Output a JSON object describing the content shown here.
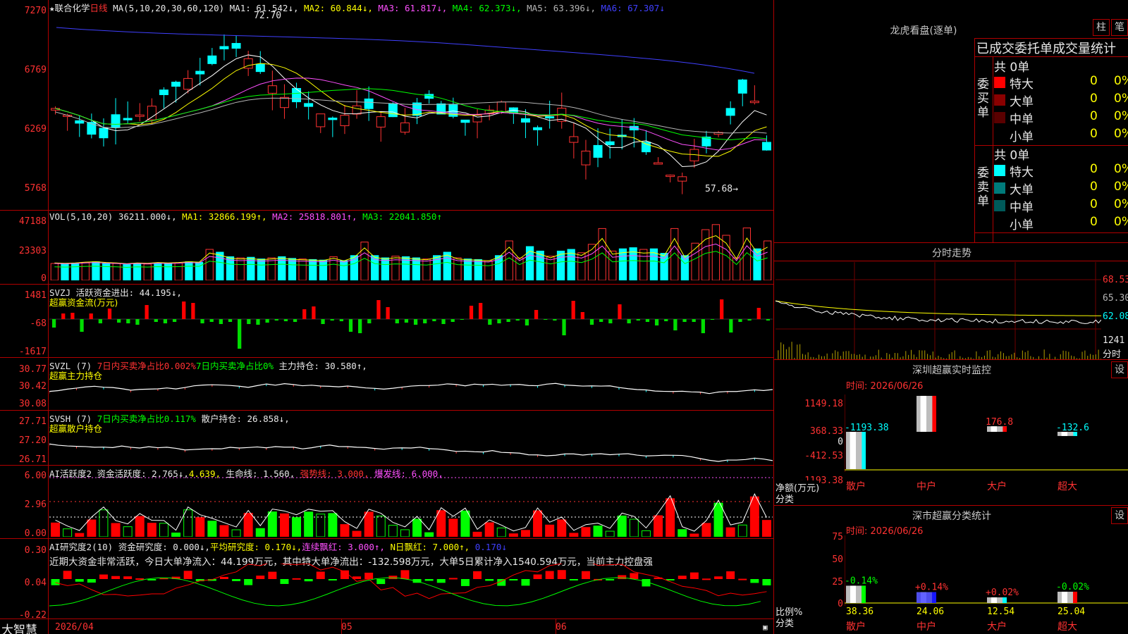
{
  "stock": {
    "name": "★联合化学",
    "period": "日线",
    "ma_label": "MA(5,10,20,30,60,120)",
    "ma1": "MA1: 61.542↓,",
    "ma2": "MA2: 60.844↓,",
    "ma3": "MA3: 61.817↓,",
    "ma4": "MA4: 62.373↓,",
    "ma5": "MA5: 63.396↓,",
    "ma6": "MA6: 67.307↓",
    "high_mark": "72.70",
    "low_mark": "57.68→",
    "price_ticks": [
      "7270",
      "6769",
      "6269",
      "5768"
    ]
  },
  "vol": {
    "legend": "VOL(5,10,20)",
    "val": "36211.000↓,",
    "ma1": "MA1: 32866.199↑,",
    "ma2": "MA2: 25818.801↑,",
    "ma3": "MA3: 22041.850↑",
    "ticks": [
      "47188",
      "23303",
      "0"
    ],
    "values": [
      30,
      29,
      30,
      32,
      33,
      31,
      30,
      28,
      30,
      29,
      31,
      30,
      31,
      33,
      32,
      55,
      50,
      42,
      40,
      41,
      38,
      40,
      42,
      39,
      38,
      37,
      36,
      42,
      35,
      44,
      68,
      44,
      40,
      43,
      42,
      40,
      38,
      44,
      50,
      40,
      38,
      37,
      35,
      44,
      70,
      40,
      60,
      52,
      43,
      52,
      55,
      49,
      64,
      92,
      52,
      56,
      58,
      55,
      56,
      48,
      92,
      44,
      66,
      90,
      99,
      80,
      40,
      93,
      56,
      70
    ]
  },
  "svzj": {
    "legend": "SVZJ  活跃资金进出: 44.195↓,",
    "sub": "超赢资金流(万元)",
    "ticks": [
      "1481",
      "-68",
      "-1617"
    ],
    "values": [
      -120,
      80,
      90,
      -180,
      80,
      -60,
      150,
      -50,
      -60,
      -80,
      200,
      -40,
      -60,
      -40,
      250,
      230,
      -60,
      -40,
      -70,
      -40,
      -420,
      -70,
      -80,
      -50,
      -20,
      -30,
      -40,
      140,
      180,
      -70,
      -20,
      -30,
      -180,
      -200,
      -60,
      270,
      170,
      -60,
      -50,
      -80,
      -60,
      -30,
      -70,
      -40,
      -10,
      190,
      230,
      -80,
      -60,
      -40,
      -20,
      -90,
      130,
      -10,
      -20,
      -230,
      260,
      100,
      -80,
      -40,
      -60,
      210,
      -60,
      -20,
      -40,
      -90,
      -30,
      -160,
      -40,
      -40,
      -200,
      -10,
      280,
      -190,
      -40,
      -20,
      160,
      -20
    ]
  },
  "svzl": {
    "legend_a": "SVZL (7)",
    "legend_b": "7日内买卖净占比0.002%",
    "legend_c": "7日内买卖净占比0%",
    "legend_d": "主力持仓: 30.580↑,",
    "sub": "超赢主力持仓",
    "ticks": [
      "30.77",
      "30.42",
      "30.08"
    ]
  },
  "svsh": {
    "legend_a": "SVSH (7)",
    "legend_b": "7日内买卖净占比0.117%",
    "legend_c": "散户持仓: 26.858↓,",
    "sub": "超赢散户持仓",
    "ticks": [
      "27.71",
      "27.20",
      "26.71"
    ]
  },
  "ai1": {
    "legend_a": "AI活跃度2",
    "legend_b": "资金活跃度: 2.765↓,",
    "legend_c": "4.639,",
    "legend_d": "生命线: 1.560,",
    "legend_e": "强势线: 3.000,",
    "legend_f": "爆发线: 6.000,",
    "ticks": [
      "6.00",
      "2.96",
      "0.00"
    ]
  },
  "ai2": {
    "legend_a": "AI研究度2(10)",
    "legend_b": "资金研究度: 0.000↓,",
    "legend_c": "平均研究度: 0.170↓,",
    "legend_d": "连续飘红: 3.000↑,",
    "legend_e": "N日飘红: 7.000↑,",
    "legend_f": "0.170↓",
    "note": "近期大资金非常活跃，今日大单净流入：44.199万元，其中特大单净流出：-132.598万元，大单5日累计净入1540.594万元，当前主力控盘强",
    "ticks": [
      "0.30",
      "0.04",
      "-0.22"
    ]
  },
  "bottom": {
    "brand": "大智慧",
    "date": "2026/04",
    "m05": "05",
    "m06": "06"
  },
  "lhb": {
    "title": "龙虎看盘(逐单)",
    "btn_zhu": "柱",
    "btn_bi": "笔",
    "header": "已成交委托单成交量统计",
    "buy_label": "委买单",
    "sell_label": "委卖单",
    "buy_total": "共 0单",
    "sell_total": "共 0单",
    "buy_rows": [
      {
        "name": "特大",
        "count": "0",
        "pct": "0%",
        "color": "#ff0000"
      },
      {
        "name": "大单",
        "count": "0",
        "pct": "0%",
        "color": "#8a0000"
      },
      {
        "name": "中单",
        "count": "0",
        "pct": "0%",
        "color": "#5a0000"
      },
      {
        "name": "小单",
        "count": "0",
        "pct": "0%",
        "color": ""
      }
    ],
    "sell_rows": [
      {
        "name": "特大",
        "count": "0",
        "pct": "0%",
        "color": "#00ffff"
      },
      {
        "name": "大单",
        "count": "0",
        "pct": "0%",
        "color": "#007a7a"
      },
      {
        "name": "中单",
        "count": "0",
        "pct": "0%",
        "color": "#005a5a"
      },
      {
        "name": "小单",
        "count": "0",
        "pct": "0%",
        "color": ""
      }
    ]
  },
  "intraday": {
    "title": "分时走势",
    "ticks": [
      "68.53",
      "65.30",
      "62.08"
    ],
    "vol_tick": "1241",
    "vol_unit": "分时"
  },
  "sz_monitor": {
    "title": "深圳超赢实时监控",
    "btn": "设",
    "time": "时间: 2026/06/26",
    "ticks": [
      "1149.18",
      "368.33",
      "0",
      "-412.53",
      "-1193.38"
    ],
    "ylabel_a": "净额(万元)",
    "ylabel_b": "分类",
    "bars": [
      {
        "label": "散户",
        "value": -1193.38,
        "text": "-1193.38"
      },
      {
        "label": "中户",
        "value": 1149.18,
        "text": "1149.18"
      },
      {
        "label": "大户",
        "value": 176.8,
        "text": "176.8"
      },
      {
        "label": "超大",
        "value": -132.6,
        "text": "-132.6"
      }
    ]
  },
  "sz_class": {
    "title": "深市超赢分类统计",
    "btn": "设",
    "time": "时间: 2026/06/26",
    "ticks": [
      "75",
      "50",
      "25",
      "0"
    ],
    "ylabel_a": "比例%",
    "ylabel_b": "分类",
    "bars": [
      {
        "label": "散户",
        "value": 38.36,
        "text": "38.36",
        "delta": "-0.14%"
      },
      {
        "label": "中户",
        "value": 24.06,
        "text": "24.06",
        "delta": "+0.14%"
      },
      {
        "label": "大户",
        "value": 12.54,
        "text": "12.54",
        "delta": "+0.02%"
      },
      {
        "label": "超大",
        "value": 25.04,
        "text": "25.04",
        "delta": "-0.02%"
      }
    ]
  }
}
